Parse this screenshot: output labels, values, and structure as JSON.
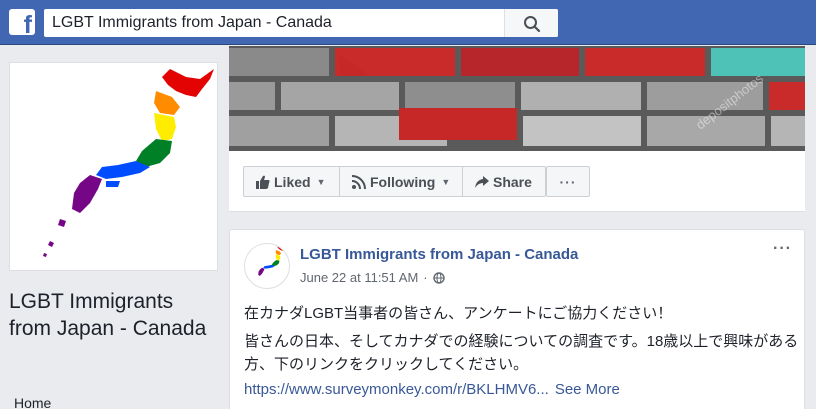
{
  "header": {
    "logo_letter": "f",
    "search_value": "LGBT Immigrants from Japan - Canada"
  },
  "sidebar": {
    "page_name": "LGBT Immigrants from Japan - Canada",
    "nav_items": [
      "Home"
    ]
  },
  "actions": {
    "liked": "Liked",
    "following": "Following",
    "share": "Share",
    "more": "···"
  },
  "post": {
    "author": "LGBT Immigrants from Japan - Canada",
    "timestamp": "June 22 at 11:51 AM",
    "separator": "·",
    "line1": "在カナダLGBT当事者の皆さん、アンケートにご協力ください！",
    "line2": "皆さんの日本、そしてカナダでの経験についての調査です。18歳以上で興味がある方、下のリンクをクリックしてください。",
    "link": "https://www.surveymonkey.com/r/BKLHMV6...",
    "see_more": "See More",
    "menu": "···"
  },
  "cover": {
    "watermark": "depositphotos"
  },
  "colors": {
    "brand": "#4267b2",
    "link": "#385898",
    "pride": [
      "#e40303",
      "#ff8c00",
      "#ffed00",
      "#008026",
      "#004dff",
      "#750787"
    ]
  }
}
